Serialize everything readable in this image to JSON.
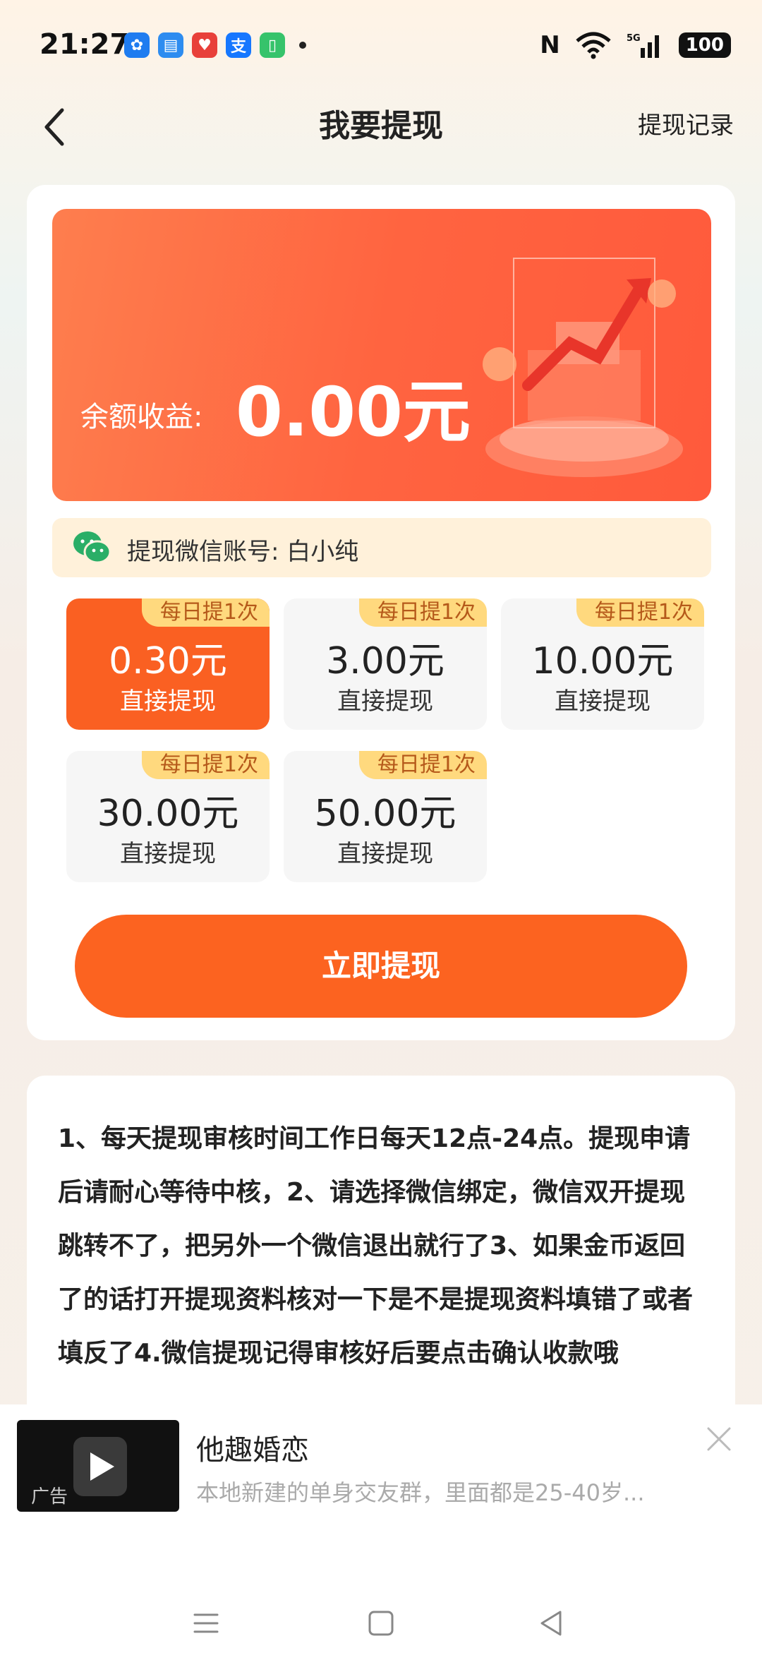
{
  "status_bar": {
    "time": "21:27",
    "network": "5G",
    "battery": "100",
    "app_icons": [
      "pinwheel-app-icon",
      "message-app-icon",
      "charity-app-icon",
      "alipay-app-icon",
      "battery-app-icon"
    ]
  },
  "header": {
    "title": "我要提现",
    "records_label": "提现记录"
  },
  "balance": {
    "label": "余额收益:",
    "value": "0.00元"
  },
  "wechat": {
    "account_text": "提现微信账号: 白小纯"
  },
  "options": [
    {
      "tag": "每日提1次",
      "amount": "0.30元",
      "sub": "直接提现",
      "selected": true
    },
    {
      "tag": "每日提1次",
      "amount": "3.00元",
      "sub": "直接提现",
      "selected": false
    },
    {
      "tag": "每日提1次",
      "amount": "10.00元",
      "sub": "直接提现",
      "selected": false
    },
    {
      "tag": "每日提1次",
      "amount": "30.00元",
      "sub": "直接提现",
      "selected": false
    },
    {
      "tag": "每日提1次",
      "amount": "50.00元",
      "sub": "直接提现",
      "selected": false
    }
  ],
  "cta": {
    "label": "立即提现"
  },
  "rules": {
    "text": "1、每天提现审核时间工作日每天12点-24点。提现申请后请耐心等待中核，2、请选择微信绑定，微信双开提现跳转不了，把另外一个微信退出就行了3、如果金币返回了的话打开提现资料核对一下是不是提现资料填错了或者填反了4.微信提现记得审核好后要点击确认收款哦"
  },
  "ad": {
    "badge": "广告",
    "title": "他趣婚恋",
    "desc": "本地新建的单身交友群，里面都是25-40岁..."
  },
  "colors": {
    "accent": "#fc6320",
    "tag_bg": "#ffd97e",
    "wechat_green": "#2aae67"
  }
}
